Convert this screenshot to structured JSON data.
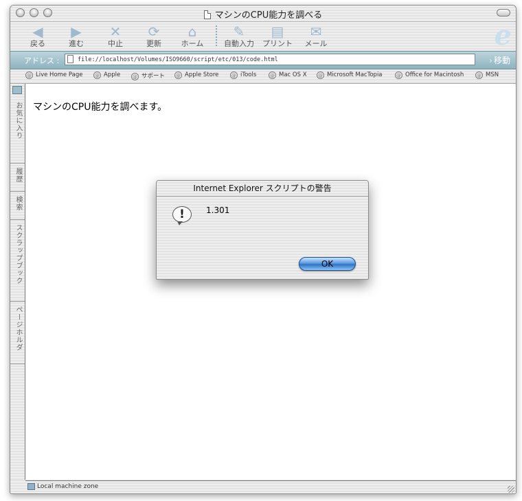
{
  "window": {
    "title": "マシンのCPU能力を調べる"
  },
  "toolbar": {
    "buttons": [
      {
        "label": "戻る",
        "icon": "back-arrow-icon"
      },
      {
        "label": "進む",
        "icon": "forward-arrow-icon"
      },
      {
        "label": "中止",
        "icon": "stop-x-icon"
      },
      {
        "label": "更新",
        "icon": "refresh-icon"
      },
      {
        "label": "ホーム",
        "icon": "home-icon"
      },
      {
        "label": "自動入力",
        "icon": "autofill-pen-icon"
      },
      {
        "label": "プリント",
        "icon": "printer-icon"
      },
      {
        "label": "メール",
        "icon": "mail-icon"
      }
    ]
  },
  "address": {
    "label": "アドレス :",
    "url": "file://localhost/Volumes/ISO9660/script/etc/013/code.html",
    "go_label": "移動"
  },
  "favorites": [
    "Live Home Page",
    "Apple",
    "サポート",
    "Apple Store",
    "iTools",
    "Mac OS X",
    "Microsoft MacTopia",
    "Office for Macintosh",
    "MSN"
  ],
  "sidebar": {
    "tabs": [
      "お気に入り",
      "履歴",
      "検索",
      "スクラップブック",
      "ページホルダ"
    ]
  },
  "page": {
    "text": "マシンのCPU能力を調べます。"
  },
  "status": {
    "zone": "Local machine zone"
  },
  "dialog": {
    "title": "Internet Explorer スクリプトの警告",
    "message": "1.301",
    "ok_label": "OK"
  }
}
